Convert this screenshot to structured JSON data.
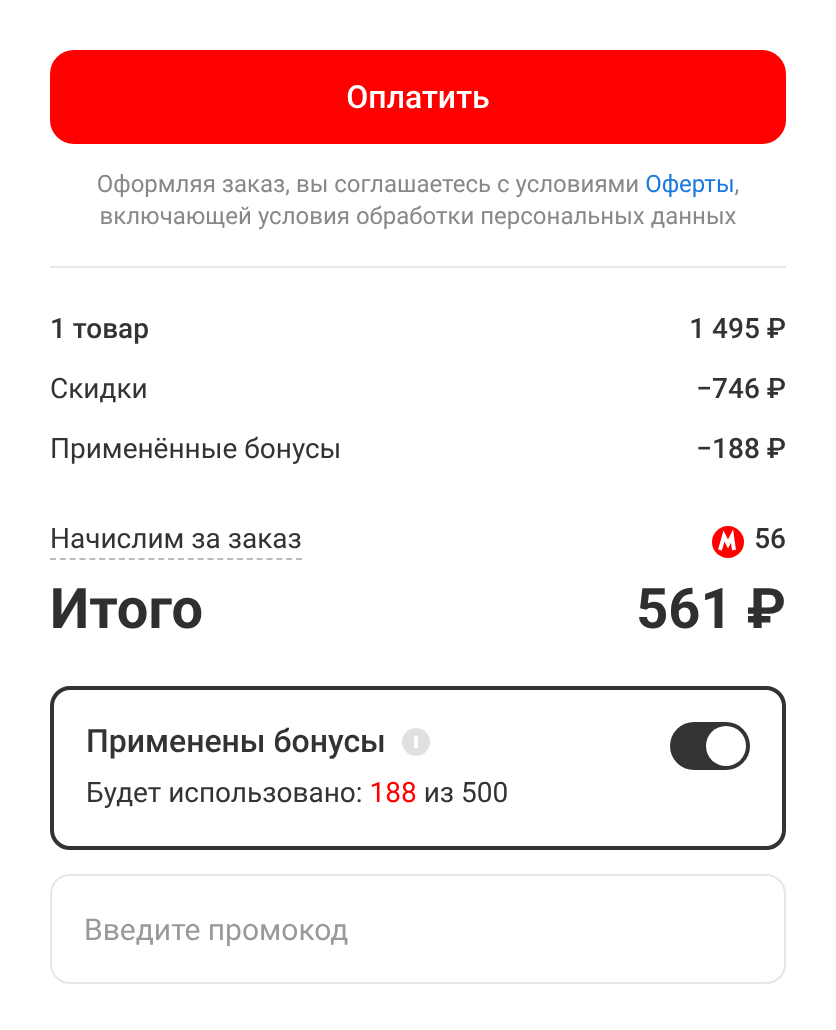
{
  "pay_button": {
    "label": "Оплатить"
  },
  "terms": {
    "before": "Оформляя заказ, вы соглашаетесь с условиями ",
    "link": "Оферты",
    "after": ", включающей условия обработки персональных данных"
  },
  "summary": [
    {
      "label": "1 товар",
      "value": "1 495 ₽"
    },
    {
      "label": "Скидки",
      "value": "−746 ₽"
    },
    {
      "label": "Применённые бонусы",
      "value": "−188 ₽"
    }
  ],
  "accrual": {
    "label": "Начислим за заказ",
    "value": "56"
  },
  "total": {
    "label": "Итого",
    "value": "561 ₽"
  },
  "bonus_card": {
    "title": "Применены бонусы",
    "on": true,
    "usage": {
      "before": "Будет использовано: ",
      "amount": "188",
      "after": " из 500"
    }
  },
  "promo": {
    "placeholder": "Введите промокод"
  }
}
